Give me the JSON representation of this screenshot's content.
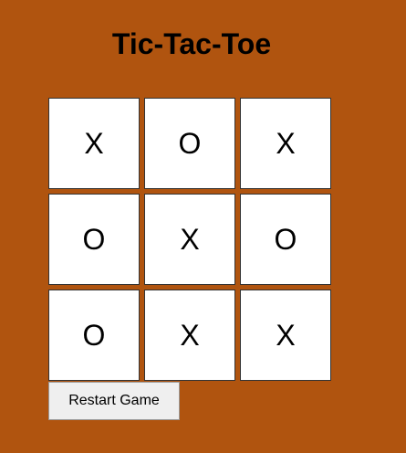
{
  "game": {
    "title": "Tic-Tac-Toe",
    "restart_label": "Restart Game",
    "board": [
      [
        "X",
        "O",
        "X"
      ],
      [
        "O",
        "X",
        "O"
      ],
      [
        "O",
        "X",
        "X"
      ]
    ]
  },
  "colors": {
    "background": "#b0540f",
    "cell_background": "#ffffff",
    "cell_border": "#333333",
    "button_background": "#efefef",
    "text": "#000000"
  }
}
